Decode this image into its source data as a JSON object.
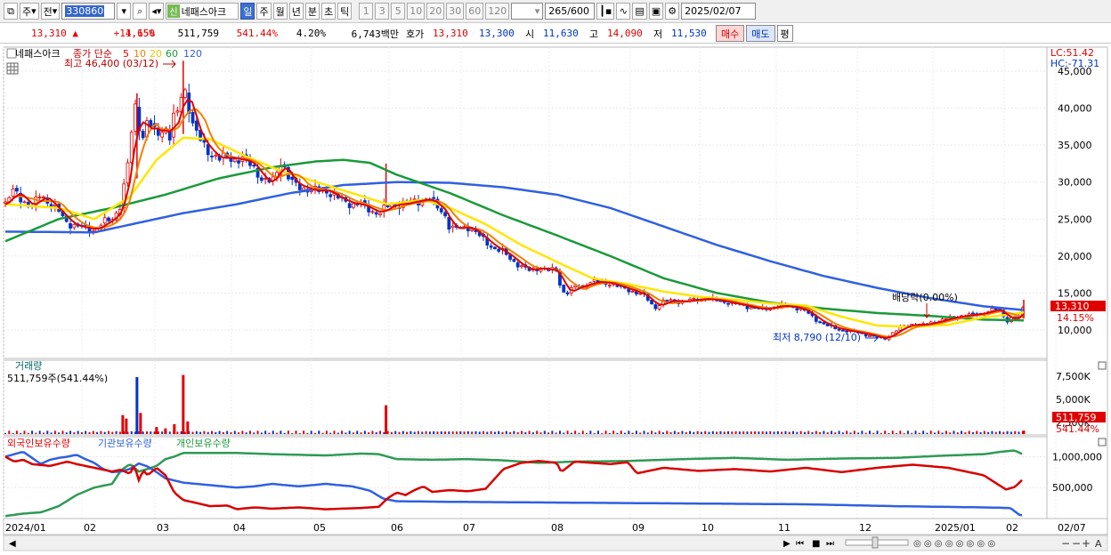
{
  "toolbar": {
    "period_type": "주",
    "prev_label": "전",
    "stock_code": "330860",
    "new_badge": "신",
    "stock_name": "네패스아크",
    "periods": [
      "일",
      "주",
      "월",
      "년",
      "분",
      "초",
      "틱"
    ],
    "active_period": "일",
    "minute_options": [
      "1",
      "3",
      "5",
      "10",
      "20",
      "30",
      "60",
      "120"
    ],
    "count": "265",
    "count_total": "/600",
    "date": "2025/02/07"
  },
  "quote": {
    "price": "13,310",
    "change": "1,650",
    "change_pct": "+14.15%",
    "volume": "511,759",
    "volume_ratio": "541.44%",
    "turnover": "4.20%",
    "amount": "6,743백만",
    "ask_label": "호가",
    "ask": "13,310",
    "bid": "13,300",
    "open_label": "시",
    "open": "11,630",
    "high_label": "고",
    "high": "14,090",
    "low_label": "저",
    "low": "11,530",
    "buy_label": "매수",
    "sell_label": "매도",
    "eval_label": "평"
  },
  "price_pane": {
    "title": "네패스아크",
    "ma_label": "종가 단순",
    "ma_periods": [
      "5",
      "10",
      "20",
      "60",
      "120"
    ],
    "lc": "LC:51.42",
    "hc": "HC:-71.31",
    "high_annot": "최고 46,400 (03/12)",
    "low_annot": "최저 8,790 (12/10)",
    "dividend_annot": "배당락(0.00%)",
    "current_price_tag": "13,310",
    "current_pct_tag": "14.15%",
    "y_ticks": [
      "45,000",
      "40,000",
      "35,000",
      "30,000",
      "25,000",
      "20,000",
      "15,000",
      "10,000"
    ]
  },
  "volume_pane": {
    "title": "거래량",
    "summary": "511,759주(541.44%)",
    "y_ticks": [
      "7,500K",
      "5,000K",
      "2,500K"
    ],
    "current_tag": "511,759",
    "pct_tag": "541.44%"
  },
  "holdings_pane": {
    "legend": [
      "외국인보유수량",
      "기관보유수량",
      "개인보유수량"
    ],
    "y_ticks": [
      "1,000,000",
      "500,000"
    ]
  },
  "x_axis": {
    "labels": [
      "2024/01",
      "02",
      "03",
      "04",
      "05",
      "06",
      "07",
      "08",
      "09",
      "10",
      "11",
      "12",
      "2025/01",
      "02",
      "02/07"
    ]
  },
  "colors": {
    "ma5": "#e00000",
    "ma10": "#f08000",
    "ma20": "#ffe600",
    "ma60": "#1a9a3a",
    "ma120": "#3060e0",
    "up": "#e00000",
    "down": "#0033cc"
  },
  "chart_data": {
    "type": "line",
    "price_path": [
      [
        0,
        27000
      ],
      [
        10,
        29000
      ],
      [
        20,
        27500
      ],
      [
        30,
        26500
      ],
      [
        40,
        28500
      ],
      [
        50,
        27000
      ],
      [
        60,
        26000
      ],
      [
        70,
        24500
      ],
      [
        80,
        24000
      ],
      [
        90,
        23800
      ],
      [
        100,
        23500
      ],
      [
        110,
        24500
      ],
      [
        120,
        25000
      ],
      [
        130,
        27000
      ],
      [
        140,
        34000
      ],
      [
        145,
        41000
      ],
      [
        150,
        38000
      ],
      [
        155,
        36000
      ],
      [
        160,
        38500
      ],
      [
        165,
        37000
      ],
      [
        170,
        36500
      ],
      [
        175,
        37000
      ],
      [
        180,
        37500
      ],
      [
        185,
        36000
      ],
      [
        190,
        39000
      ],
      [
        195,
        39500
      ],
      [
        200,
        43500
      ],
      [
        205,
        41000
      ],
      [
        210,
        38000
      ],
      [
        215,
        36500
      ],
      [
        220,
        35500
      ],
      [
        230,
        34000
      ],
      [
        240,
        33000
      ],
      [
        250,
        33500
      ],
      [
        260,
        33000
      ],
      [
        270,
        33000
      ],
      [
        280,
        32000
      ],
      [
        290,
        30000
      ],
      [
        300,
        30000
      ],
      [
        310,
        33000
      ],
      [
        320,
        30000
      ],
      [
        330,
        29500
      ],
      [
        340,
        29000
      ],
      [
        350,
        28800
      ],
      [
        360,
        29000
      ],
      [
        370,
        28000
      ],
      [
        380,
        27500
      ],
      [
        390,
        27000
      ],
      [
        400,
        27000
      ],
      [
        410,
        26200
      ],
      [
        420,
        25800
      ],
      [
        428,
        26500
      ],
      [
        435,
        27000
      ],
      [
        445,
        27000
      ],
      [
        455,
        27300
      ],
      [
        465,
        27500
      ],
      [
        475,
        27800
      ],
      [
        485,
        26800
      ],
      [
        495,
        25500
      ],
      [
        500,
        23500
      ],
      [
        510,
        23800
      ],
      [
        520,
        24000
      ],
      [
        530,
        23000
      ],
      [
        540,
        22000
      ],
      [
        550,
        21000
      ],
      [
        560,
        20500
      ],
      [
        570,
        19500
      ],
      [
        580,
        18500
      ],
      [
        590,
        18000
      ],
      [
        600,
        18500
      ],
      [
        610,
        18000
      ],
      [
        620,
        18200
      ],
      [
        625,
        15500
      ],
      [
        630,
        14800
      ],
      [
        640,
        15800
      ],
      [
        650,
        16000
      ],
      [
        660,
        16500
      ],
      [
        670,
        16500
      ],
      [
        680,
        16300
      ],
      [
        690,
        15800
      ],
      [
        700,
        15500
      ],
      [
        710,
        15000
      ],
      [
        720,
        14500
      ],
      [
        730,
        13000
      ],
      [
        740,
        13800
      ],
      [
        750,
        14000
      ],
      [
        760,
        13800
      ],
      [
        770,
        14000
      ],
      [
        780,
        14200
      ],
      [
        790,
        14200
      ],
      [
        800,
        14000
      ],
      [
        810,
        13800
      ],
      [
        820,
        13500
      ],
      [
        830,
        13300
      ],
      [
        840,
        13000
      ],
      [
        850,
        12800
      ],
      [
        860,
        13000
      ],
      [
        870,
        13300
      ],
      [
        880,
        13200
      ],
      [
        890,
        13000
      ],
      [
        900,
        12500
      ],
      [
        910,
        11500
      ],
      [
        920,
        10800
      ],
      [
        930,
        10300
      ],
      [
        940,
        10000
      ],
      [
        950,
        9800
      ],
      [
        960,
        9600
      ],
      [
        970,
        9300
      ],
      [
        980,
        9000
      ],
      [
        988,
        8800
      ],
      [
        1000,
        9800
      ],
      [
        1010,
        10500
      ],
      [
        1020,
        10800
      ],
      [
        1030,
        10600
      ],
      [
        1040,
        11000
      ],
      [
        1050,
        11200
      ],
      [
        1060,
        11600
      ],
      [
        1070,
        11800
      ],
      [
        1080,
        12000
      ],
      [
        1090,
        12100
      ],
      [
        1100,
        12300
      ],
      [
        1110,
        12700
      ],
      [
        1115,
        12800
      ],
      [
        1120,
        12500
      ],
      [
        1125,
        11200
      ],
      [
        1130,
        11500
      ],
      [
        1135,
        11800
      ],
      [
        1140,
        11600
      ],
      [
        1145,
        13310
      ]
    ],
    "ma120_path": [
      [
        0,
        23300
      ],
      [
        100,
        23200
      ],
      [
        150,
        24500
      ],
      [
        200,
        25800
      ],
      [
        260,
        27000
      ],
      [
        320,
        28500
      ],
      [
        380,
        29600
      ],
      [
        440,
        30000
      ],
      [
        500,
        29900
      ],
      [
        560,
        29300
      ],
      [
        620,
        28300
      ],
      [
        680,
        26500
      ],
      [
        740,
        24000
      ],
      [
        800,
        21500
      ],
      [
        860,
        19300
      ],
      [
        920,
        17300
      ],
      [
        980,
        15700
      ],
      [
        1040,
        14300
      ],
      [
        1100,
        13200
      ],
      [
        1145,
        12700
      ]
    ],
    "ma60_path": [
      [
        0,
        22000
      ],
      [
        60,
        25000
      ],
      [
        120,
        26500
      ],
      [
        180,
        28300
      ],
      [
        240,
        30500
      ],
      [
        300,
        32000
      ],
      [
        350,
        32800
      ],
      [
        380,
        33000
      ],
      [
        410,
        32600
      ],
      [
        440,
        31000
      ],
      [
        500,
        28500
      ],
      [
        560,
        25500
      ],
      [
        620,
        22800
      ],
      [
        680,
        20000
      ],
      [
        740,
        17000
      ],
      [
        800,
        15000
      ],
      [
        860,
        13700
      ],
      [
        920,
        12900
      ],
      [
        980,
        12300
      ],
      [
        1040,
        11900
      ],
      [
        1100,
        11400
      ],
      [
        1145,
        11300
      ]
    ],
    "ma20_path": [
      [
        0,
        27000
      ],
      [
        60,
        26500
      ],
      [
        100,
        25000
      ],
      [
        140,
        28000
      ],
      [
        170,
        33000
      ],
      [
        200,
        36000
      ],
      [
        230,
        35800
      ],
      [
        270,
        33500
      ],
      [
        310,
        31500
      ],
      [
        350,
        30000
      ],
      [
        390,
        28500
      ],
      [
        430,
        27000
      ],
      [
        470,
        27600
      ],
      [
        500,
        26500
      ],
      [
        540,
        24300
      ],
      [
        580,
        21500
      ],
      [
        620,
        19200
      ],
      [
        660,
        17000
      ],
      [
        700,
        16200
      ],
      [
        740,
        15200
      ],
      [
        780,
        14500
      ],
      [
        820,
        14100
      ],
      [
        860,
        13600
      ],
      [
        900,
        13300
      ],
      [
        940,
        11800
      ],
      [
        980,
        10600
      ],
      [
        1020,
        10400
      ],
      [
        1060,
        10700
      ],
      [
        1100,
        11700
      ],
      [
        1130,
        12100
      ],
      [
        1145,
        12400
      ]
    ],
    "volume_spikes": [
      [
        132,
        2.7
      ],
      [
        136,
        2.2
      ],
      [
        148,
        8.1
      ],
      [
        152,
        3.0
      ],
      [
        170,
        1.0
      ],
      [
        180,
        0.8
      ],
      [
        190,
        1.4
      ],
      [
        200,
        8.4
      ],
      [
        205,
        1.8
      ],
      [
        428,
        4.1
      ]
    ],
    "holdings_foreign": [
      [
        0,
        1000000
      ],
      [
        10,
        920000
      ],
      [
        20,
        950000
      ],
      [
        30,
        880000
      ],
      [
        50,
        850000
      ],
      [
        70,
        920000
      ],
      [
        80,
        880000
      ],
      [
        100,
        820000
      ],
      [
        120,
        760000
      ],
      [
        130,
        790000
      ],
      [
        140,
        720000
      ],
      [
        145,
        860000
      ],
      [
        150,
        620000
      ],
      [
        155,
        780000
      ],
      [
        160,
        700000
      ],
      [
        170,
        820000
      ],
      [
        180,
        700000
      ],
      [
        190,
        420000
      ],
      [
        200,
        300000
      ],
      [
        215,
        250000
      ],
      [
        230,
        200000
      ],
      [
        250,
        210000
      ],
      [
        260,
        150000
      ],
      [
        280,
        180000
      ],
      [
        300,
        160000
      ],
      [
        330,
        180000
      ],
      [
        360,
        150000
      ],
      [
        400,
        170000
      ],
      [
        420,
        190000
      ],
      [
        430,
        330000
      ],
      [
        440,
        420000
      ],
      [
        450,
        380000
      ],
      [
        460,
        460000
      ],
      [
        470,
        520000
      ],
      [
        480,
        430000
      ],
      [
        500,
        460000
      ],
      [
        520,
        440000
      ],
      [
        540,
        480000
      ],
      [
        560,
        800000
      ],
      [
        580,
        900000
      ],
      [
        600,
        930000
      ],
      [
        620,
        900000
      ],
      [
        625,
        750000
      ],
      [
        640,
        920000
      ],
      [
        660,
        900000
      ],
      [
        680,
        880000
      ],
      [
        700,
        910000
      ],
      [
        710,
        730000
      ],
      [
        740,
        820000
      ],
      [
        780,
        770000
      ],
      [
        820,
        800000
      ],
      [
        860,
        760000
      ],
      [
        900,
        820000
      ],
      [
        940,
        750000
      ],
      [
        980,
        820000
      ],
      [
        1020,
        870000
      ],
      [
        1060,
        820000
      ],
      [
        1080,
        760000
      ],
      [
        1100,
        700000
      ],
      [
        1115,
        560000
      ],
      [
        1125,
        470000
      ],
      [
        1135,
        510000
      ],
      [
        1145,
        650000
      ]
    ],
    "holdings_institution": [
      [
        0,
        1000000
      ],
      [
        20,
        1080000
      ],
      [
        30,
        980000
      ],
      [
        40,
        880000
      ],
      [
        50,
        950000
      ],
      [
        60,
        980000
      ],
      [
        70,
        1000000
      ],
      [
        80,
        1030000
      ],
      [
        90,
        960000
      ],
      [
        100,
        900000
      ],
      [
        110,
        800000
      ],
      [
        120,
        750000
      ],
      [
        130,
        760000
      ],
      [
        140,
        800000
      ],
      [
        150,
        890000
      ],
      [
        160,
        840000
      ],
      [
        170,
        750000
      ],
      [
        180,
        650000
      ],
      [
        200,
        580000
      ],
      [
        230,
        540000
      ],
      [
        260,
        500000
      ],
      [
        280,
        520000
      ],
      [
        300,
        560000
      ],
      [
        330,
        520000
      ],
      [
        360,
        560000
      ],
      [
        390,
        520000
      ],
      [
        410,
        450000
      ],
      [
        425,
        320000
      ],
      [
        440,
        280000
      ],
      [
        500,
        270000
      ],
      [
        600,
        260000
      ],
      [
        700,
        250000
      ],
      [
        800,
        240000
      ],
      [
        900,
        230000
      ],
      [
        1000,
        200000
      ],
      [
        1100,
        180000
      ],
      [
        1130,
        170000
      ],
      [
        1140,
        60000
      ],
      [
        1145,
        50000
      ]
    ],
    "holdings_individual": [
      [
        0,
        40000
      ],
      [
        20,
        80000
      ],
      [
        40,
        100000
      ],
      [
        60,
        200000
      ],
      [
        80,
        380000
      ],
      [
        100,
        500000
      ],
      [
        120,
        560000
      ],
      [
        130,
        780000
      ],
      [
        140,
        880000
      ],
      [
        150,
        760000
      ],
      [
        160,
        800000
      ],
      [
        170,
        850000
      ],
      [
        180,
        960000
      ],
      [
        190,
        1000000
      ],
      [
        200,
        1060000
      ],
      [
        260,
        1060000
      ],
      [
        300,
        1040000
      ],
      [
        360,
        1020000
      ],
      [
        400,
        1050000
      ],
      [
        420,
        1040000
      ],
      [
        440,
        960000
      ],
      [
        480,
        950000
      ],
      [
        520,
        960000
      ],
      [
        560,
        940000
      ],
      [
        600,
        900000
      ],
      [
        640,
        920000
      ],
      [
        700,
        930000
      ],
      [
        760,
        960000
      ],
      [
        820,
        980000
      ],
      [
        880,
        950000
      ],
      [
        940,
        970000
      ],
      [
        1000,
        980000
      ],
      [
        1060,
        1020000
      ],
      [
        1100,
        1040000
      ],
      [
        1120,
        1080000
      ],
      [
        1135,
        1100000
      ],
      [
        1145,
        1030000
      ]
    ]
  }
}
